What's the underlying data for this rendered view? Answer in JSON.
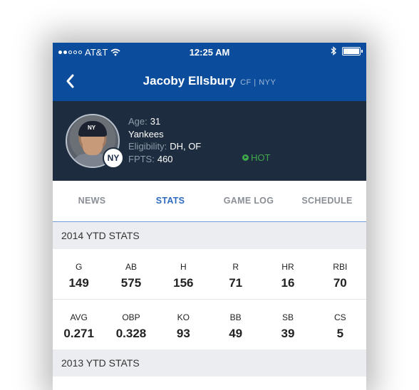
{
  "status_bar": {
    "carrier": "AT&T",
    "time": "12:25 AM"
  },
  "nav": {
    "title": "Jacoby Ellsbury",
    "subtitle": "CF | NYY"
  },
  "player": {
    "age_label": "Age:",
    "age_value": "31",
    "team": "Yankees",
    "eligibility_label": "Eligibility:",
    "eligibility_value": "DH, OF",
    "fpts_label": "FPTS:",
    "fpts_value": "460",
    "hot_label": "HOT",
    "logo_text": "NY"
  },
  "tabs": [
    "NEWS",
    "STATS",
    "GAME LOG",
    "SCHEDULE"
  ],
  "sections": {
    "ytd_2014": "2014 YTD STATS",
    "ytd_2013": "2013 YTD STATS"
  },
  "stats_2014": {
    "row1": [
      {
        "label": "G",
        "value": "149"
      },
      {
        "label": "AB",
        "value": "575"
      },
      {
        "label": "H",
        "value": "156"
      },
      {
        "label": "R",
        "value": "71"
      },
      {
        "label": "HR",
        "value": "16"
      },
      {
        "label": "RBI",
        "value": "70"
      }
    ],
    "row2": [
      {
        "label": "AVG",
        "value": "0.271"
      },
      {
        "label": "OBP",
        "value": "0.328"
      },
      {
        "label": "KO",
        "value": "93"
      },
      {
        "label": "BB",
        "value": "49"
      },
      {
        "label": "SB",
        "value": "39"
      },
      {
        "label": "CS",
        "value": "5"
      }
    ]
  },
  "colors": {
    "brand_blue": "#0b4d9c",
    "card_bg": "#1d2c3e",
    "hot_green": "#3ea84a",
    "active_tab": "#2e6bbf"
  }
}
